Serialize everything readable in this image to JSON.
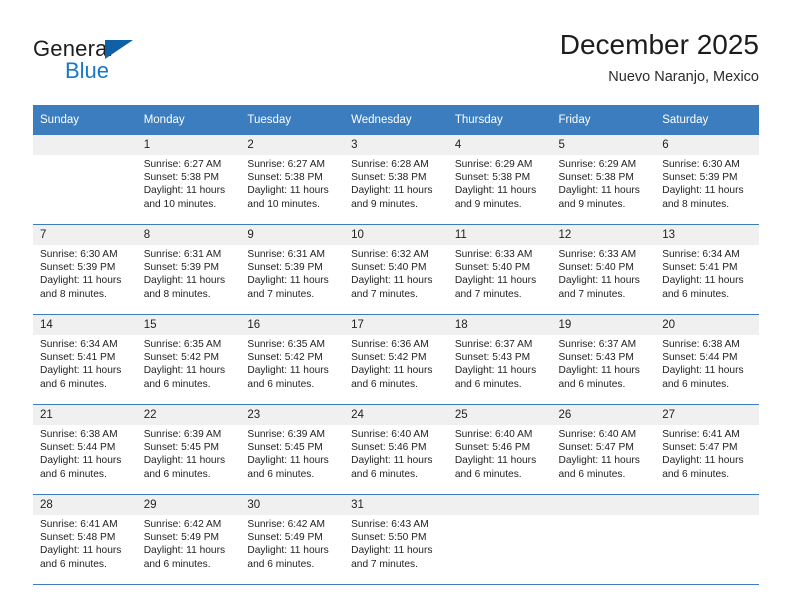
{
  "brand": {
    "word1": "General",
    "word2": "Blue",
    "triangle_color": "#1060a8",
    "blue_color": "#1878c8"
  },
  "header": {
    "month_title": "December 2025",
    "location": "Nuevo Naranjo, Mexico"
  },
  "calendar": {
    "header_bg": "#3b7dbf",
    "daynum_bg": "#f0f0f0",
    "weekdays": [
      "Sunday",
      "Monday",
      "Tuesday",
      "Wednesday",
      "Thursday",
      "Friday",
      "Saturday"
    ],
    "weeks": [
      [
        {
          "day": "",
          "empty": true
        },
        {
          "day": "1",
          "sunrise": "Sunrise: 6:27 AM",
          "sunset": "Sunset: 5:38 PM",
          "daylight1": "Daylight: 11 hours",
          "daylight2": "and 10 minutes."
        },
        {
          "day": "2",
          "sunrise": "Sunrise: 6:27 AM",
          "sunset": "Sunset: 5:38 PM",
          "daylight1": "Daylight: 11 hours",
          "daylight2": "and 10 minutes."
        },
        {
          "day": "3",
          "sunrise": "Sunrise: 6:28 AM",
          "sunset": "Sunset: 5:38 PM",
          "daylight1": "Daylight: 11 hours",
          "daylight2": "and 9 minutes."
        },
        {
          "day": "4",
          "sunrise": "Sunrise: 6:29 AM",
          "sunset": "Sunset: 5:38 PM",
          "daylight1": "Daylight: 11 hours",
          "daylight2": "and 9 minutes."
        },
        {
          "day": "5",
          "sunrise": "Sunrise: 6:29 AM",
          "sunset": "Sunset: 5:38 PM",
          "daylight1": "Daylight: 11 hours",
          "daylight2": "and 9 minutes."
        },
        {
          "day": "6",
          "sunrise": "Sunrise: 6:30 AM",
          "sunset": "Sunset: 5:39 PM",
          "daylight1": "Daylight: 11 hours",
          "daylight2": "and 8 minutes."
        }
      ],
      [
        {
          "day": "7",
          "sunrise": "Sunrise: 6:30 AM",
          "sunset": "Sunset: 5:39 PM",
          "daylight1": "Daylight: 11 hours",
          "daylight2": "and 8 minutes."
        },
        {
          "day": "8",
          "sunrise": "Sunrise: 6:31 AM",
          "sunset": "Sunset: 5:39 PM",
          "daylight1": "Daylight: 11 hours",
          "daylight2": "and 8 minutes."
        },
        {
          "day": "9",
          "sunrise": "Sunrise: 6:31 AM",
          "sunset": "Sunset: 5:39 PM",
          "daylight1": "Daylight: 11 hours",
          "daylight2": "and 7 minutes."
        },
        {
          "day": "10",
          "sunrise": "Sunrise: 6:32 AM",
          "sunset": "Sunset: 5:40 PM",
          "daylight1": "Daylight: 11 hours",
          "daylight2": "and 7 minutes."
        },
        {
          "day": "11",
          "sunrise": "Sunrise: 6:33 AM",
          "sunset": "Sunset: 5:40 PM",
          "daylight1": "Daylight: 11 hours",
          "daylight2": "and 7 minutes."
        },
        {
          "day": "12",
          "sunrise": "Sunrise: 6:33 AM",
          "sunset": "Sunset: 5:40 PM",
          "daylight1": "Daylight: 11 hours",
          "daylight2": "and 7 minutes."
        },
        {
          "day": "13",
          "sunrise": "Sunrise: 6:34 AM",
          "sunset": "Sunset: 5:41 PM",
          "daylight1": "Daylight: 11 hours",
          "daylight2": "and 6 minutes."
        }
      ],
      [
        {
          "day": "14",
          "sunrise": "Sunrise: 6:34 AM",
          "sunset": "Sunset: 5:41 PM",
          "daylight1": "Daylight: 11 hours",
          "daylight2": "and 6 minutes."
        },
        {
          "day": "15",
          "sunrise": "Sunrise: 6:35 AM",
          "sunset": "Sunset: 5:42 PM",
          "daylight1": "Daylight: 11 hours",
          "daylight2": "and 6 minutes."
        },
        {
          "day": "16",
          "sunrise": "Sunrise: 6:35 AM",
          "sunset": "Sunset: 5:42 PM",
          "daylight1": "Daylight: 11 hours",
          "daylight2": "and 6 minutes."
        },
        {
          "day": "17",
          "sunrise": "Sunrise: 6:36 AM",
          "sunset": "Sunset: 5:42 PM",
          "daylight1": "Daylight: 11 hours",
          "daylight2": "and 6 minutes."
        },
        {
          "day": "18",
          "sunrise": "Sunrise: 6:37 AM",
          "sunset": "Sunset: 5:43 PM",
          "daylight1": "Daylight: 11 hours",
          "daylight2": "and 6 minutes."
        },
        {
          "day": "19",
          "sunrise": "Sunrise: 6:37 AM",
          "sunset": "Sunset: 5:43 PM",
          "daylight1": "Daylight: 11 hours",
          "daylight2": "and 6 minutes."
        },
        {
          "day": "20",
          "sunrise": "Sunrise: 6:38 AM",
          "sunset": "Sunset: 5:44 PM",
          "daylight1": "Daylight: 11 hours",
          "daylight2": "and 6 minutes."
        }
      ],
      [
        {
          "day": "21",
          "sunrise": "Sunrise: 6:38 AM",
          "sunset": "Sunset: 5:44 PM",
          "daylight1": "Daylight: 11 hours",
          "daylight2": "and 6 minutes."
        },
        {
          "day": "22",
          "sunrise": "Sunrise: 6:39 AM",
          "sunset": "Sunset: 5:45 PM",
          "daylight1": "Daylight: 11 hours",
          "daylight2": "and 6 minutes."
        },
        {
          "day": "23",
          "sunrise": "Sunrise: 6:39 AM",
          "sunset": "Sunset: 5:45 PM",
          "daylight1": "Daylight: 11 hours",
          "daylight2": "and 6 minutes."
        },
        {
          "day": "24",
          "sunrise": "Sunrise: 6:40 AM",
          "sunset": "Sunset: 5:46 PM",
          "daylight1": "Daylight: 11 hours",
          "daylight2": "and 6 minutes."
        },
        {
          "day": "25",
          "sunrise": "Sunrise: 6:40 AM",
          "sunset": "Sunset: 5:46 PM",
          "daylight1": "Daylight: 11 hours",
          "daylight2": "and 6 minutes."
        },
        {
          "day": "26",
          "sunrise": "Sunrise: 6:40 AM",
          "sunset": "Sunset: 5:47 PM",
          "daylight1": "Daylight: 11 hours",
          "daylight2": "and 6 minutes."
        },
        {
          "day": "27",
          "sunrise": "Sunrise: 6:41 AM",
          "sunset": "Sunset: 5:47 PM",
          "daylight1": "Daylight: 11 hours",
          "daylight2": "and 6 minutes."
        }
      ],
      [
        {
          "day": "28",
          "sunrise": "Sunrise: 6:41 AM",
          "sunset": "Sunset: 5:48 PM",
          "daylight1": "Daylight: 11 hours",
          "daylight2": "and 6 minutes."
        },
        {
          "day": "29",
          "sunrise": "Sunrise: 6:42 AM",
          "sunset": "Sunset: 5:49 PM",
          "daylight1": "Daylight: 11 hours",
          "daylight2": "and 6 minutes."
        },
        {
          "day": "30",
          "sunrise": "Sunrise: 6:42 AM",
          "sunset": "Sunset: 5:49 PM",
          "daylight1": "Daylight: 11 hours",
          "daylight2": "and 6 minutes."
        },
        {
          "day": "31",
          "sunrise": "Sunrise: 6:43 AM",
          "sunset": "Sunset: 5:50 PM",
          "daylight1": "Daylight: 11 hours",
          "daylight2": "and 7 minutes."
        },
        {
          "day": "",
          "empty": true
        },
        {
          "day": "",
          "empty": true
        },
        {
          "day": "",
          "empty": true
        }
      ]
    ]
  }
}
